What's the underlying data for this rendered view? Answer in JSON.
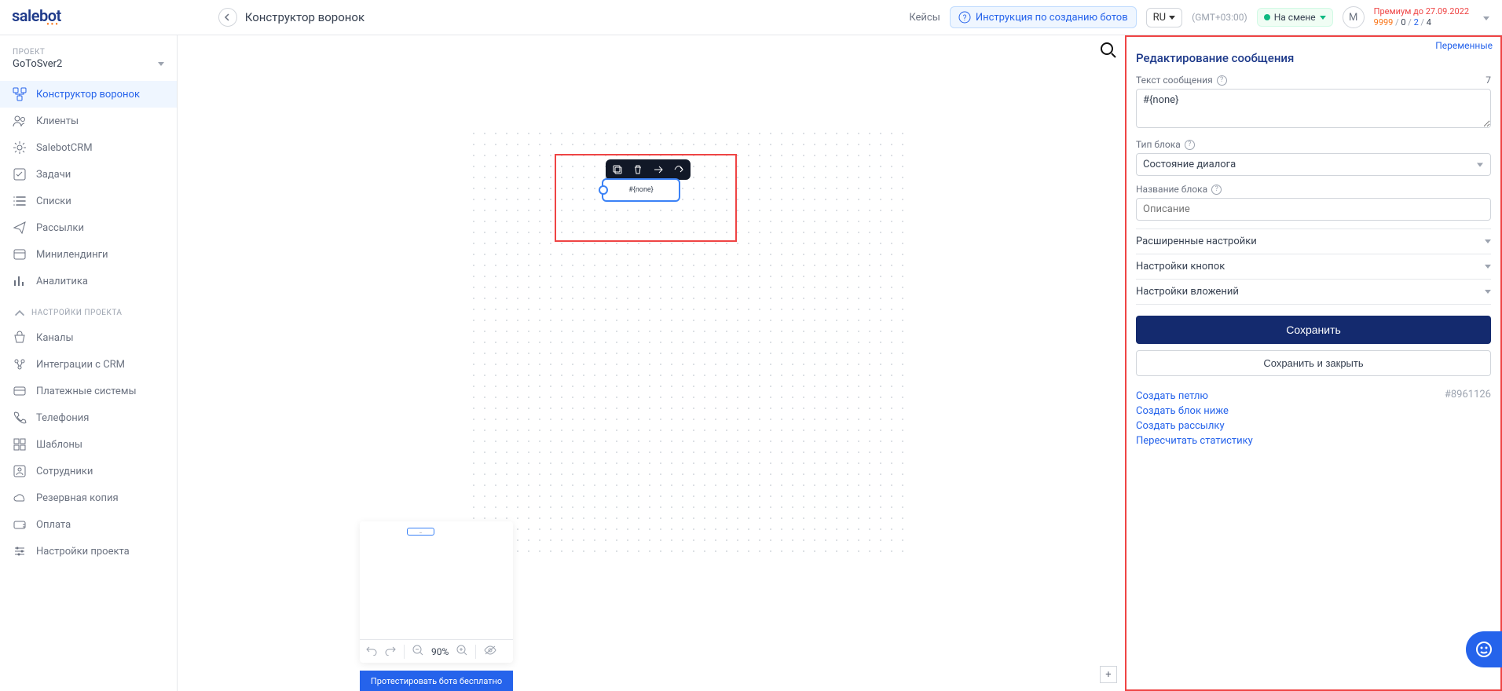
{
  "header": {
    "logo": "salebot",
    "page_title": "Конструктор воронок",
    "cases": "Кейсы",
    "help": "Инструкция по созданию ботов",
    "lang": "RU",
    "tz": "(GMT+03:00)",
    "status": "На смене",
    "avatar": "M",
    "premium": "Премиум до 27.09.2022",
    "stat_a": "9999",
    "stat_b": "0",
    "stat_c": "2",
    "stat_d": "4"
  },
  "sidebar": {
    "project_label": "ПРОЕКТ",
    "project_name": "GoToSver2",
    "items": [
      "Конструктор воронок",
      "Клиенты",
      "SalebotCRM",
      "Задачи",
      "Списки",
      "Рассылки",
      "Минилендинги",
      "Аналитика"
    ],
    "section": "НАСТРОЙКИ ПРОЕКТА",
    "items2": [
      "Каналы",
      "Интеграции с CRM",
      "Платежные системы",
      "Телефония",
      "Шаблоны",
      "Сотрудники",
      "Резервная копия",
      "Оплата",
      "Настройки проекта"
    ]
  },
  "canvas": {
    "node_text": "#{none}",
    "zoom": "90%",
    "test_btn": "Протестировать бота бесплатно",
    "mm_node": "…"
  },
  "panel": {
    "vars": "Переменные",
    "title": "Редактирование сообщения",
    "msg_label": "Текст сообщения",
    "msg_count": "7",
    "msg_value": "#{none}",
    "type_label": "Тип блока",
    "type_value": "Состояние диалога",
    "name_label": "Название блока",
    "name_placeholder": "Описание",
    "acc1": "Расширенные настройки",
    "acc2": "Настройки кнопок",
    "acc3": "Настройки вложений",
    "save": "Сохранить",
    "save_close": "Сохранить и закрыть",
    "links": [
      "Создать петлю",
      "Создать блок ниже",
      "Создать рассылку",
      "Пересчитать статистику"
    ],
    "block_id": "#8961126"
  }
}
